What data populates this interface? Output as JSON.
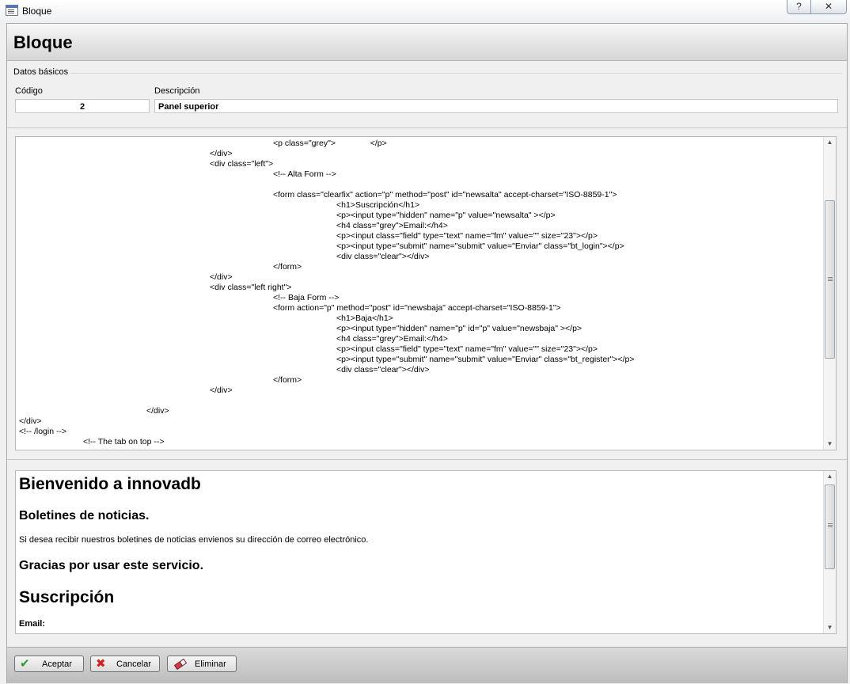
{
  "window": {
    "title": "Bloque",
    "help_glyph": "?",
    "close_glyph": "✕"
  },
  "page_title": "Bloque",
  "group": {
    "title": "Datos básicos"
  },
  "fields": {
    "codigo": {
      "label": "Código",
      "value": "2"
    },
    "descripcion": {
      "label": "Descripción",
      "value": "Panel superior"
    }
  },
  "code_lines": [
    "<p class=\"grey\">               </p>",
    "</div>",
    "<div class=\"left\">",
    "<!-- Alta Form -->",
    "",
    "<form class=\"clearfix\" action=\"p\" method=\"post\" id=\"newsalta\" accept-charset=\"ISO-8859-1\">",
    "<h1>Suscripción</h1>",
    "<p><input type=\"hidden\" name=\"p\" value=\"newsalta\" ></p>",
    "<h4 class=\"grey\">Email:</h4>",
    "<p><input class=\"field\" type=\"text\" name=\"fm\" value=\"\" size=\"23\"></p>",
    "<p><input type=\"submit\" name=\"submit\" value=\"Enviar\" class=\"bt_login\"></p>",
    "<div class=\"clear\"></div>",
    "</form>",
    "</div>",
    "<div class=\"left right\">",
    "<!-- Baja Form -->",
    "<form action=\"p\" method=\"post\" id=\"newsbaja\" accept-charset=\"ISO-8859-1\">",
    "<h1>Baja</h1>",
    "<p><input type=\"hidden\" name=\"p\" id=\"p\" value=\"newsbaja\" ></p>",
    "<h4 class=\"grey\">Email:</h4>",
    "<p><input class=\"field\" type=\"text\" name=\"fm\" value=\"\" size=\"23\"></p>",
    "<p><input type=\"submit\" name=\"submit\" value=\"Enviar\" class=\"bt_register\"></p>",
    "<div class=\"clear\"></div>",
    "</form>",
    "</div>",
    "",
    "</div>",
    "</div>",
    "<!-- /login -->",
    "<!-- The tab on top -->"
  ],
  "preview": {
    "h1": "Bienvenido a innovadb",
    "h2": "Boletines de noticias.",
    "p": "Si desea recibir nuestros boletines de noticias envienos su dirección de correo electrónico.",
    "h2b": "Gracias por usar este servicio.",
    "h1b": "Suscripción",
    "h4": "Email:"
  },
  "buttons": {
    "accept": {
      "label": "Aceptar",
      "icon": "check-icon"
    },
    "cancel": {
      "label": "Cancelar",
      "icon": "x-icon"
    },
    "delete": {
      "label": "Eliminar",
      "icon": "eraser-icon"
    }
  },
  "colors": {
    "accept_icon": "#2e9a2e",
    "cancel_icon": "#d42020",
    "delete_icon": "#d63a4a"
  }
}
